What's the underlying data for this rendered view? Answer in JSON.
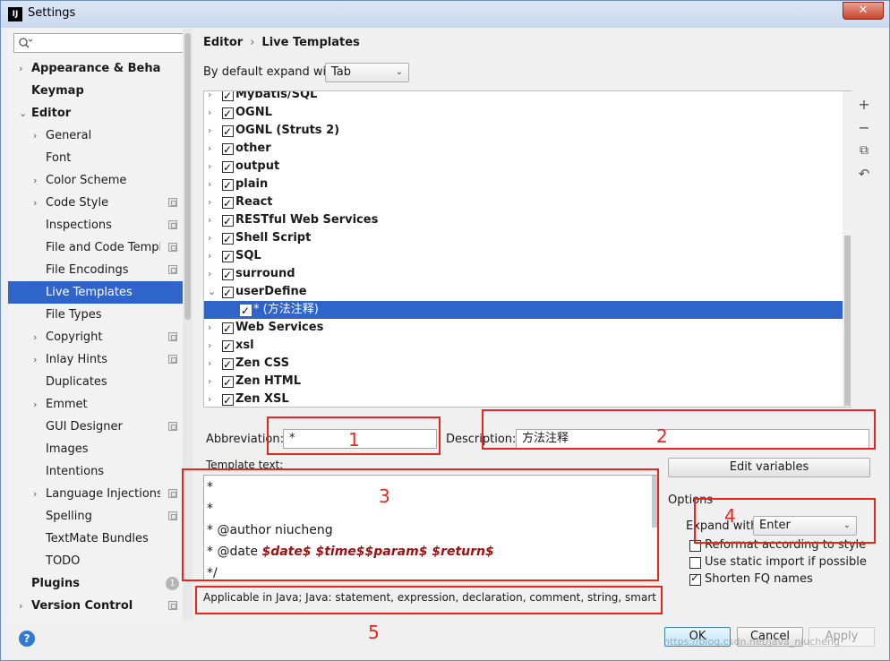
{
  "window": {
    "title": "Settings",
    "app_icon": "IJ"
  },
  "search": {
    "placeholder": ""
  },
  "sidebar": {
    "items": [
      {
        "label": "Appearance & Behavior",
        "expandable": true,
        "bold": true
      },
      {
        "label": "Keymap",
        "bold": true
      },
      {
        "label": "Editor",
        "expanded": true,
        "bold": true
      },
      {
        "label": "General",
        "expandable": true
      },
      {
        "label": "Font"
      },
      {
        "label": "Color Scheme",
        "expandable": true
      },
      {
        "label": "Code Style",
        "expandable": true,
        "project": true
      },
      {
        "label": "Inspections",
        "project": true
      },
      {
        "label": "File and Code Templates",
        "project": true
      },
      {
        "label": "File Encodings",
        "project": true
      },
      {
        "label": "Live Templates",
        "selected": true
      },
      {
        "label": "File Types"
      },
      {
        "label": "Copyright",
        "expandable": true,
        "project": true
      },
      {
        "label": "Inlay Hints",
        "expandable": true,
        "project": true
      },
      {
        "label": "Duplicates"
      },
      {
        "label": "Emmet",
        "expandable": true
      },
      {
        "label": "GUI Designer",
        "project": true
      },
      {
        "label": "Images"
      },
      {
        "label": "Intentions"
      },
      {
        "label": "Language Injections",
        "expandable": true,
        "project": true
      },
      {
        "label": "Spelling",
        "project": true
      },
      {
        "label": "TextMate Bundles"
      },
      {
        "label": "TODO"
      },
      {
        "label": "Plugins",
        "bold": true,
        "badge": "1"
      },
      {
        "label": "Version Control",
        "expandable": true,
        "bold": true,
        "project": true
      }
    ]
  },
  "breadcrumb": {
    "parent": "Editor",
    "sep": "›",
    "current": "Live Templates"
  },
  "expand_default": {
    "label": "By default expand with",
    "value": "Tab"
  },
  "templates": [
    {
      "label": "Mybatis/SQL",
      "checked": true
    },
    {
      "label": "OGNL",
      "checked": true
    },
    {
      "label": "OGNL (Struts 2)",
      "checked": true
    },
    {
      "label": "other",
      "checked": true
    },
    {
      "label": "output",
      "checked": true
    },
    {
      "label": "plain",
      "checked": true
    },
    {
      "label": "React",
      "checked": true
    },
    {
      "label": "RESTful Web Services",
      "checked": true
    },
    {
      "label": "Shell Script",
      "checked": true
    },
    {
      "label": "SQL",
      "checked": true
    },
    {
      "label": "surround",
      "checked": true
    },
    {
      "label": "userDefine",
      "checked": true,
      "expanded": true
    },
    {
      "label": "* (方法注释)",
      "checked": true,
      "selected": true,
      "child": true
    },
    {
      "label": "Web Services",
      "checked": true
    },
    {
      "label": "xsl",
      "checked": true
    },
    {
      "label": "Zen CSS",
      "checked": true
    },
    {
      "label": "Zen HTML",
      "checked": true
    },
    {
      "label": "Zen XSL",
      "checked": true
    }
  ],
  "toolbar": {
    "add": "+",
    "remove": "−",
    "copy": "⧉",
    "restore": "↶"
  },
  "abbreviation": {
    "label": "Abbreviation:",
    "value": "*"
  },
  "description": {
    "label": "Description:",
    "value": "方法注释"
  },
  "template_text": {
    "label": "Template text:",
    "lines": [
      "*",
      "*",
      "* @author niucheng"
    ],
    "date_prefix": "* @date ",
    "date_vars": "$date$ $time$$param$ $return$",
    "last_line": "*/"
  },
  "edit_variables": "Edit variables",
  "options": {
    "title": "Options",
    "expand_with_label": "Expand with",
    "expand_with_value": "Enter",
    "reformat": {
      "label": "Reformat according to style",
      "checked": false
    },
    "static_import": {
      "label": "Use static import if possible",
      "checked": false
    },
    "shorten_fq": {
      "label": "Shorten FQ names",
      "checked": true
    }
  },
  "applicable": "Applicable in Java; Java: statement, expression, declaration, comment, string, smart type",
  "buttons": {
    "ok": "OK",
    "cancel": "Cancel",
    "apply": "Apply",
    "help": "?"
  },
  "annotations": [
    "1",
    "2",
    "3",
    "4",
    "5"
  ],
  "watermark": "https://blog.csdn.net/java_niucheng",
  "colors": {
    "selection": "#2f65ca",
    "annotation": "#e8261e",
    "variable": "#a01010"
  }
}
